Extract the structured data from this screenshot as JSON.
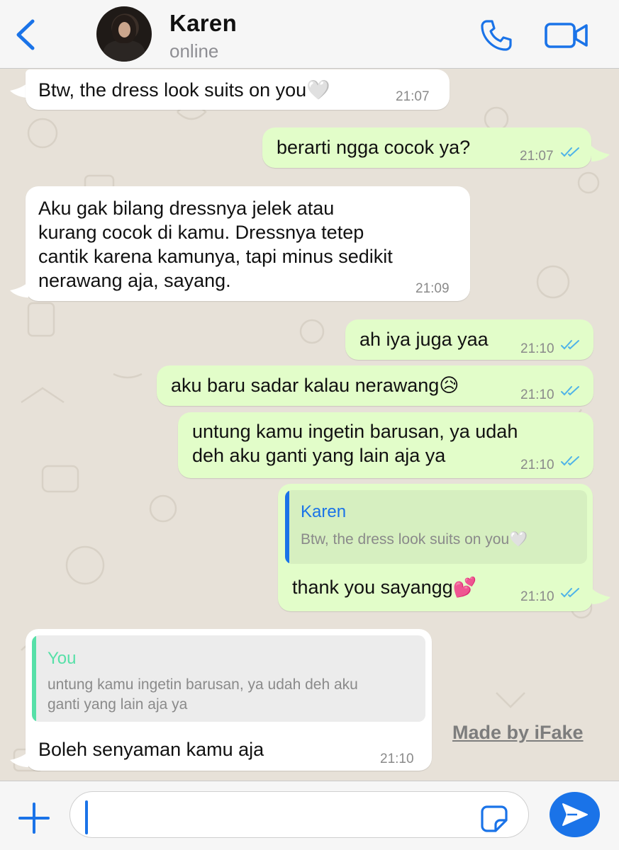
{
  "header": {
    "contact_name": "Karen",
    "status": "online",
    "back_icon": "chevron-left-icon",
    "call_icon": "phone-icon",
    "video_icon": "video-camera-icon"
  },
  "messages": [
    {
      "direction": "in",
      "text": "Btw, the dress look suits on you🤍",
      "time": "21:07"
    },
    {
      "direction": "out",
      "text": "berarti ngga cocok ya?",
      "time": "21:07"
    },
    {
      "direction": "in",
      "lines": [
        "Aku gak bilang dressnya jelek atau",
        "kurang cocok di kamu. Dressnya tetep",
        "cantik karena kamunya, tapi minus sedikit",
        "nerawang aja, sayang."
      ],
      "time": "21:09"
    },
    {
      "direction": "out",
      "text": "ah iya juga yaa",
      "time": "21:10"
    },
    {
      "direction": "out",
      "text": "aku baru sadar kalau nerawang😥",
      "time": "21:10"
    },
    {
      "direction": "out",
      "lines": [
        "untung kamu ingetin barusan, ya udah",
        "deh aku ganti yang lain aja ya"
      ],
      "time": "21:10"
    },
    {
      "direction": "out",
      "quote": {
        "name": "Karen",
        "text": "Btw, the dress look suits on you🤍"
      },
      "text": "thank you sayangg💕",
      "time": "21:10"
    },
    {
      "direction": "in",
      "quote": {
        "name": "You",
        "lines": [
          "untung kamu ingetin barusan, ya udah deh aku",
          "ganti yang lain aja ya"
        ]
      },
      "text": "Boleh senyaman kamu aja",
      "time": "21:10"
    }
  ],
  "watermark": "Made by iFake",
  "composer": {
    "plus_icon": "plus-icon",
    "sticker_icon": "sticker-icon",
    "send_icon": "send-icon"
  },
  "colors": {
    "accent": "#1a73e8",
    "incoming_bubble": "#ffffff",
    "outgoing_bubble": "#e2fdc9",
    "chat_background": "#e7e1d8",
    "read_ticks": "#4fb3e8",
    "quote_bar_karen": "#1a73e8",
    "quote_bar_you": "#57e0a8"
  }
}
